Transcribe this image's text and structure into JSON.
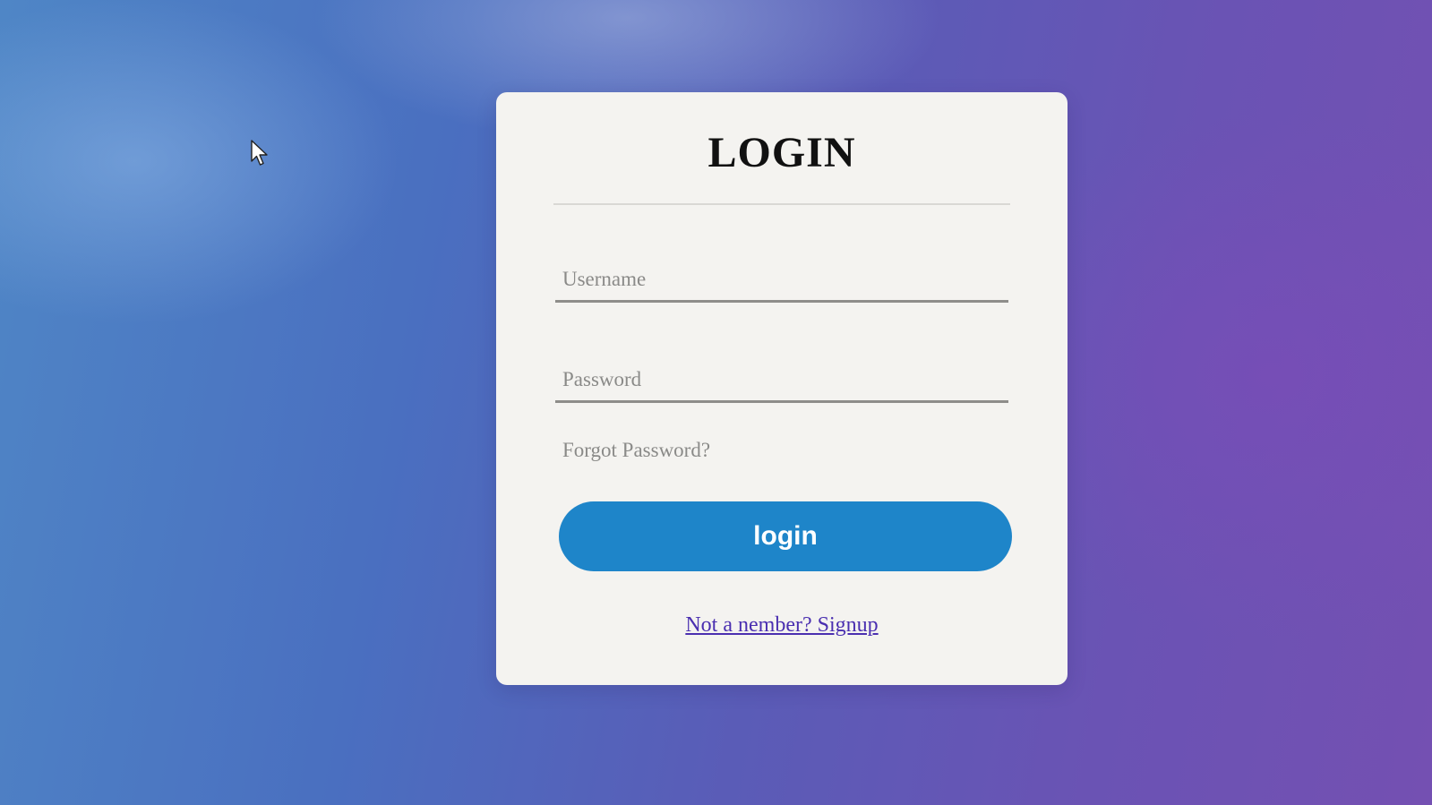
{
  "login_card": {
    "title": "LOGIN",
    "username_placeholder": "Username",
    "password_placeholder": "Password",
    "forgot_password_label": "Forgot Password?",
    "login_button_label": "login",
    "signup_link_label": "Not a nember? Signup"
  },
  "colors": {
    "login_button": "#1e85c9",
    "signup_link": "#4a2fb0",
    "card_background": "#f4f3f0"
  },
  "icons": {
    "cursor": "mouse-pointer-icon"
  }
}
